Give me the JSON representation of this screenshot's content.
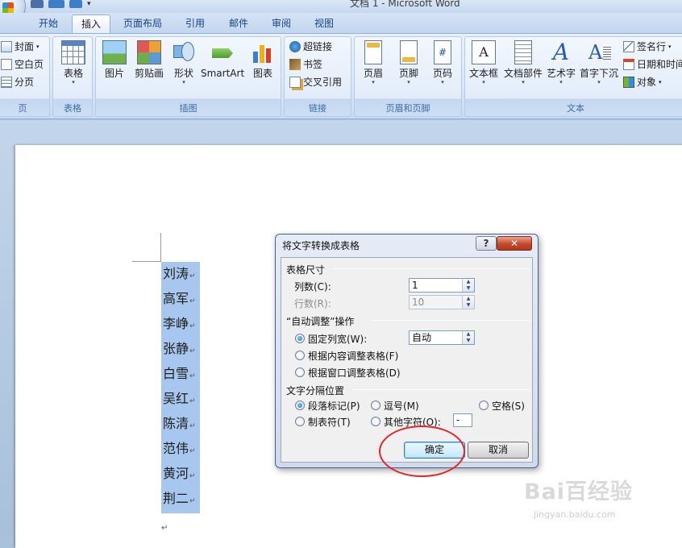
{
  "title_bar": {
    "title": "文档 1 - Microsoft Word"
  },
  "tabs": [
    "开始",
    "插入",
    "页面布局",
    "引用",
    "邮件",
    "审阅",
    "视图"
  ],
  "active_tab": "插入",
  "ribbon": {
    "pages": {
      "items": [
        "封面",
        "空白页",
        "分页"
      ],
      "label": "页"
    },
    "table": {
      "button": "表格",
      "label": "表格"
    },
    "illustrations": {
      "buttons": [
        "图片",
        "剪贴画",
        "形状",
        "SmartArt",
        "图表"
      ],
      "label": "插图"
    },
    "links": {
      "items": [
        "超链接",
        "书签",
        "交叉引用"
      ],
      "label": "链接"
    },
    "header_footer": {
      "buttons": [
        "页眉",
        "页脚",
        "页码"
      ],
      "label": "页眉和页脚"
    },
    "text": {
      "buttons": [
        "文本框",
        "文档部件",
        "艺术字",
        "首字下沉"
      ],
      "small_items": [
        "签名行",
        "日期和时间",
        "对象"
      ],
      "label": "文本"
    }
  },
  "document": {
    "names": [
      "刘涛",
      "高军",
      "李峥",
      "张静",
      "白雪",
      "吴红",
      "陈清",
      "范伟",
      "黄河",
      "荆二"
    ],
    "paragraph_mark": "↵"
  },
  "dialog": {
    "title": "将文字转换成表格",
    "help": "?",
    "close": "✕",
    "table_size": {
      "section": "表格尺寸",
      "columns_label": "列数(C):",
      "columns_value": "1",
      "rows_label": "行数(R):",
      "rows_value": "10"
    },
    "autofit": {
      "section": "“自动调整”操作",
      "fixed_width": "固定列宽(W):",
      "fixed_width_value": "自动",
      "fit_content": "根据内容调整表格(F)",
      "fit_window": "根据窗口调整表格(D)"
    },
    "separator": {
      "section": "文字分隔位置",
      "paragraph": "段落标记(P)",
      "comma": "逗号(M)",
      "space": "空格(S)",
      "tab": "制表符(T)",
      "other": "其他字符(O):",
      "other_value": "-"
    },
    "ok": "确定",
    "cancel": "取消"
  },
  "watermark": {
    "main": "Bai百经验",
    "sub": "jingyan.baidu.com"
  },
  "colors": {
    "accent": "#15428b",
    "selection": "#a7c7ee",
    "close_button": "#c7472a",
    "annotation_circle": "#e2262b"
  }
}
